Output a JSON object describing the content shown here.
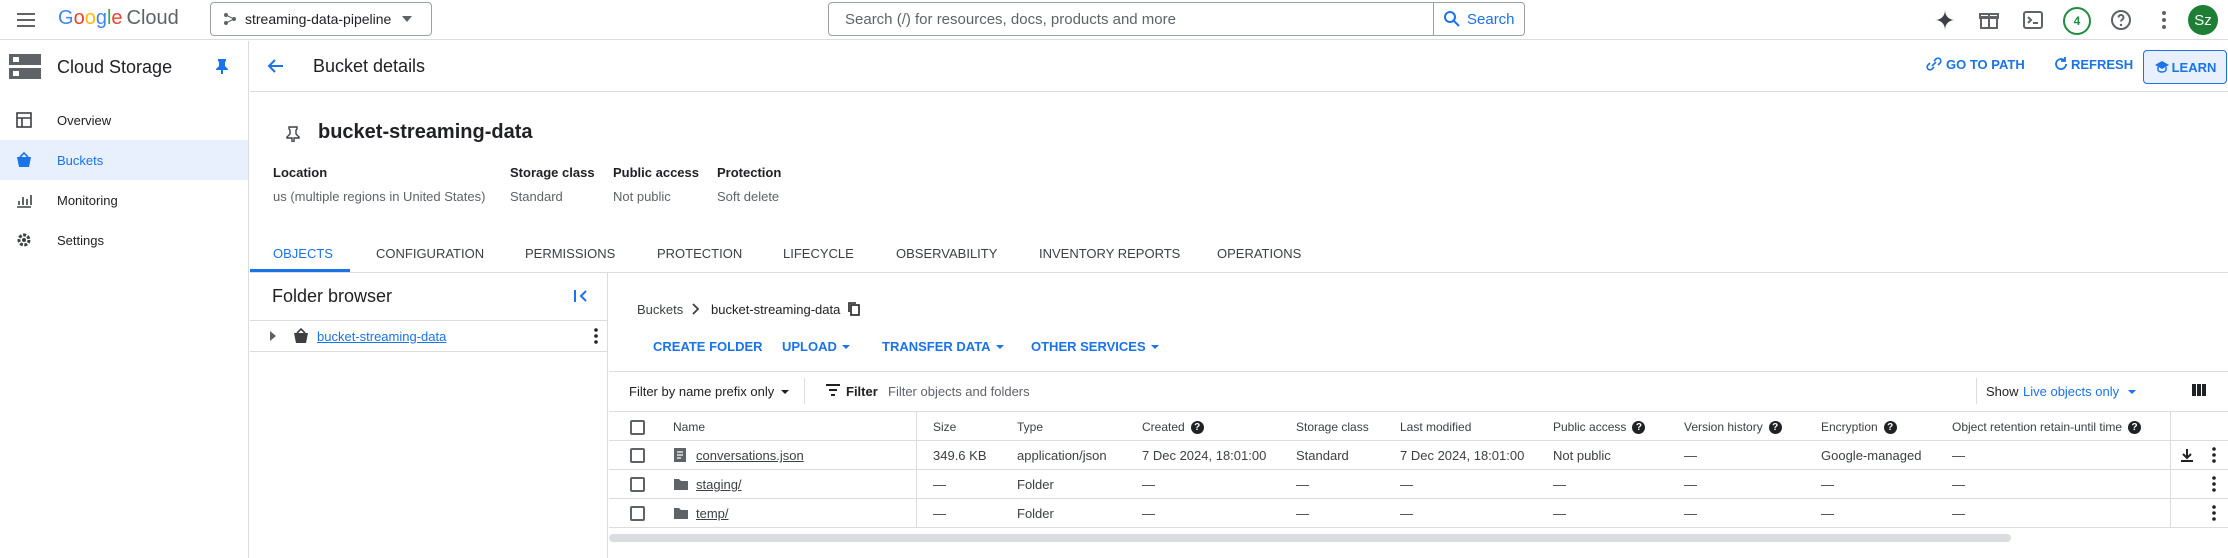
{
  "topbar": {
    "logo_g": "G",
    "logo_o1": "o",
    "logo_o2": "o",
    "logo_g2": "g",
    "logo_l": "l",
    "logo_e": "e",
    "logo_cloud": "Cloud",
    "project": "streaming-data-pipeline",
    "search_placeholder": "Search (/) for resources, docs, products and more",
    "search_button": "Search",
    "notifications_count": "4",
    "avatar_initials": "Sz"
  },
  "sidenav": {
    "title": "Cloud Storage",
    "items": [
      {
        "label": "Overview",
        "icon": "dashboard-icon"
      },
      {
        "label": "Buckets",
        "icon": "bucket-icon"
      },
      {
        "label": "Monitoring",
        "icon": "chart-icon"
      },
      {
        "label": "Settings",
        "icon": "gear-icon"
      }
    ]
  },
  "header": {
    "title": "Bucket details",
    "go_to_path": "GO TO PATH",
    "refresh": "REFRESH",
    "learn": "LEARN"
  },
  "bucket": {
    "name": "bucket-streaming-data",
    "meta": [
      {
        "label": "Location",
        "value": "us (multiple regions in United States)"
      },
      {
        "label": "Storage class",
        "value": "Standard"
      },
      {
        "label": "Public access",
        "value": "Not public"
      },
      {
        "label": "Protection",
        "value": "Soft delete"
      }
    ]
  },
  "tabs": [
    "OBJECTS",
    "CONFIGURATION",
    "PERMISSIONS",
    "PROTECTION",
    "LIFECYCLE",
    "OBSERVABILITY",
    "INVENTORY REPORTS",
    "OPERATIONS"
  ],
  "folder_browser": {
    "title": "Folder browser",
    "root": "bucket-streaming-data"
  },
  "breadcrumb": {
    "root": "Buckets",
    "current": "bucket-streaming-data"
  },
  "actions": {
    "create_folder": "CREATE FOLDER",
    "upload": "UPLOAD",
    "transfer_data": "TRANSFER DATA",
    "other_services": "OTHER SERVICES"
  },
  "filter": {
    "prefix_select": "Filter by name prefix only",
    "filter_label": "Filter",
    "filter_placeholder": "Filter objects and folders",
    "show_label": "Show",
    "show_value": "Live objects only"
  },
  "table": {
    "columns": [
      "Name",
      "Size",
      "Type",
      "Created",
      "Storage class",
      "Last modified",
      "Public access",
      "Version history",
      "Encryption",
      "Object retention retain-until time"
    ],
    "rows": [
      {
        "name": "conversations.json",
        "size": "349.6 KB",
        "type": "application/json",
        "created": "7 Dec 2024, 18:01:00",
        "storage_class": "Standard",
        "last_modified": "7 Dec 2024, 18:01:00",
        "public_access": "Not public",
        "version_history": "—",
        "encryption": "Google-managed",
        "retention": "—"
      },
      {
        "name": "staging/",
        "size": "—",
        "type": "Folder",
        "created": "—",
        "storage_class": "—",
        "last_modified": "—",
        "public_access": "—",
        "version_history": "—",
        "encryption": "—",
        "retention": "—"
      },
      {
        "name": "temp/",
        "size": "—",
        "type": "Folder",
        "created": "—",
        "storage_class": "—",
        "last_modified": "—",
        "public_access": "—",
        "version_history": "—",
        "encryption": "—",
        "retention": "—"
      }
    ]
  },
  "colors": {
    "accent": "#1a73e8",
    "link": "#1a0dab",
    "avatar": "#1e7e34",
    "badge": "#1e8e3e"
  }
}
